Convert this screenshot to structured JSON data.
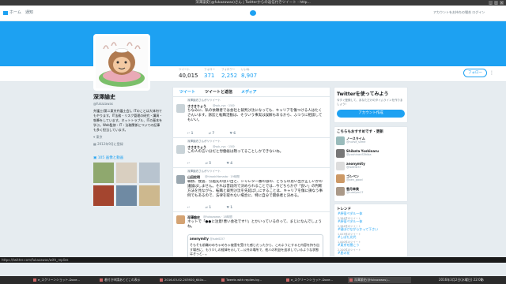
{
  "window": {
    "title": "深澤諭史(@fukazawas)さん | Twitterからの返信付きツイート - http..."
  },
  "nav": {
    "home": "ホーム",
    "notifications": "通知",
    "search_placeholder": "Twitter を検索",
    "account_text": "アカウントをお持ちの場合 ログイン",
    "tweet_button": "ツイート"
  },
  "stats": [
    {
      "label": "ツイート",
      "value": "40,015"
    },
    {
      "label": "フォロー",
      "value": "371"
    },
    {
      "label": "フォロワー",
      "value": "2,252"
    },
    {
      "label": "いいね",
      "value": "8,907"
    }
  ],
  "follow_button": "フォロー",
  "profile": {
    "name": "深澤諭史",
    "handle": "@fukazawas",
    "bio": "弁護士(第二東京弁護士会)。ITのことは大体何でもやります。IT法務・リスク管理の研究・講演・執筆をしています。ネットトラブル、ITの基本を学ぶ。Web監修・IT・法務関係についての記事も多く担当しています。",
    "location": "東京",
    "joined": "2012年9月に登録",
    "photos_label": "105 画像と動画"
  },
  "timeline": {
    "tabs": [
      "ツイート",
      "ツイートと返信",
      "メディア"
    ],
    "tweets": [
      {
        "retweeted_by": "深澤諭史さんがリツイート",
        "name": "ささきりょう",
        "handle": "@ssk_ryo · 15分",
        "text": "ちなみに、私の依頼者では会社と裁判沙汰になっても、キャリアを傷つける人はたくさんいます。訴訟と転職活動は、そういう事実は誤解もあるから、ふつうに相談してもいい。",
        "replies": "1",
        "rts": "7",
        "likes": "6"
      },
      {
        "retweeted_by": "深澤諭史さんがリツイート",
        "name": "ささきりょう",
        "handle": "@ssk_ryo · 15分",
        "text": "この人の言い分だと労働省は黙ってることしかできないね。",
        "replies": "",
        "rts": "5",
        "likes": "4"
      },
      {
        "retweeted_by": "深澤諭史さんがリツイート",
        "name": "山田宏明",
        "handle": "@hiroakiYamada · 19時間",
        "text": "職務、捜査、引越先の思い出と、シャレタ一番の旅の、どちらの思い出が正しいかの議論はしません。それは普段的で決められることでは...今どちらかが「良い」の判断方法を見ながら、転職と裁判沙汰を先延ばしにすることは、キャリアを傷に損なう事例でもあるので、法律を取れない場合に、特に自分で関係者と決める。",
        "replies": "",
        "rts": "1",
        "likes": "1"
      },
      {
        "retweeted_by": "",
        "name": "深澤諭史",
        "handle": "@fukazawas · 18時間",
        "text": "ネットで「●●に注意!悪い会社です!!」とかいっているのって、まじになんでしょうね。",
        "quote_name": "anonymity",
        "quote_handle": "@isdelD37",
        "quote_text": "そもそも前職のめちゃめちゃ被害を受けた感じだったから、このようにすると内容を持ち出す場合に、もう少しの経緯を示して...公共の場所で、他人の利益を追求しているような状態はきっと…。",
        "replies": "",
        "rts": "",
        "likes": ""
      }
    ]
  },
  "sidebar": {
    "signup_title": "Twitterを使ってみよう",
    "signup_sub": "今すぐ登録して、あなただけのタイムラインを作りましょう!",
    "signup_button": "アカウント作成",
    "suggestions_title": "こちらもおすすめです · 更新",
    "suggestions": [
      {
        "name": "ノースライム",
        "handle": "@nurse_slime"
      },
      {
        "name": "Shibata Yoshinaru",
        "handle": "@yoshinariS5hiba"
      },
      {
        "name": "anonymity",
        "handle": "@isdelD37"
      },
      {
        "name": "ゴシペン",
        "handle": "@pen_good"
      },
      {
        "name": "香月幸美",
        "handle": "@lurefpm17"
      }
    ],
    "trends_title": "トレンド",
    "trends": [
      {
        "tag": "#原宿ペダル一体",
        "count": "2,364件のツイート"
      },
      {
        "tag": "#原宿ペダル一体",
        "count": "2,364件のツイート"
      },
      {
        "tag": "#寝ぼけながらかって下さい",
        "count": "1,023件のツイート"
      },
      {
        "tag": "#しばた光代",
        "count": "1,000件のツイート"
      },
      {
        "tag": "#東京を聞こう",
        "count": "2,200件のツイート"
      },
      {
        "tag": "#星の花",
        "count": "15件のツイート"
      }
    ]
  },
  "status_url": "https://twitter.com/fukazawas/with_replies",
  "taskbar": {
    "items": [
      "e_スクリーンショット-Dove...",
      "着付き申請あとどこの表示",
      "2016-03-02-203920_640x...",
      "Tweets with replies by...",
      "e_スクリーンショット-Dove...",
      "深澤諭史(@fukazawas)..."
    ],
    "clock": "2016年3月2日(水曜日) 22:00",
    "ime": "あ"
  },
  "colors": {
    "accent": "#1da1f2",
    "banner": "#1da1f2"
  }
}
